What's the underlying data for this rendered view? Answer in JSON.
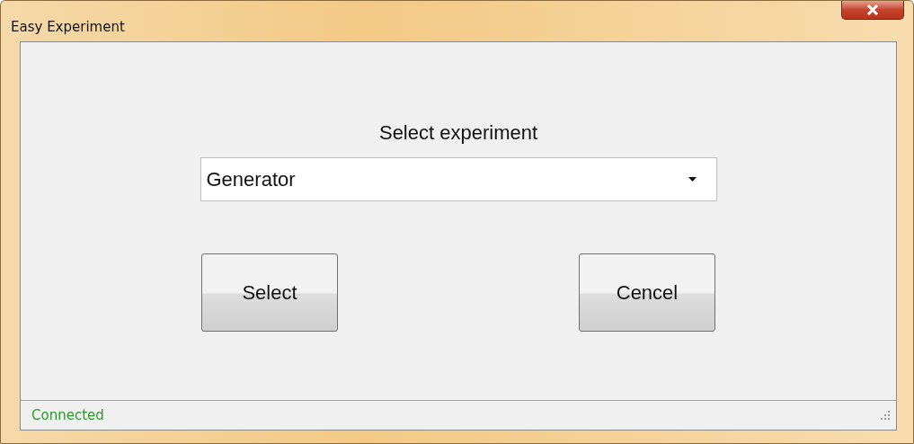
{
  "window": {
    "title": "Easy Experiment"
  },
  "prompt": "Select experiment",
  "experiment_select": {
    "value": "Generator"
  },
  "buttons": [
    {
      "label": "Select"
    },
    {
      "label": "Cencel"
    }
  ],
  "status_bar": {
    "text": "Connected"
  }
}
